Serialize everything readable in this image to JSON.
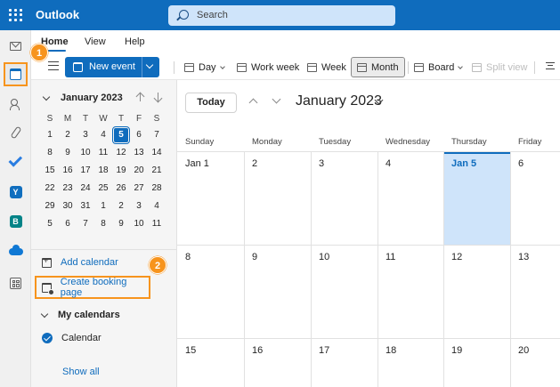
{
  "app": {
    "name": "Outlook",
    "search_placeholder": "Search"
  },
  "ribbon": {
    "tabs": [
      {
        "label": "Home"
      },
      {
        "label": "View"
      },
      {
        "label": "Help"
      }
    ],
    "new_event_label": "New event",
    "views": [
      {
        "label": "Day"
      },
      {
        "label": "Work week"
      },
      {
        "label": "Week"
      },
      {
        "label": "Month"
      },
      {
        "label": "Board"
      },
      {
        "label": "Split view"
      }
    ]
  },
  "mini_calendar": {
    "title": "January 2023",
    "day_headers": [
      "S",
      "M",
      "T",
      "W",
      "T",
      "F",
      "S"
    ],
    "weeks": [
      [
        "1",
        "2",
        "3",
        "4",
        "5",
        "6",
        "7"
      ],
      [
        "8",
        "9",
        "10",
        "11",
        "12",
        "13",
        "14"
      ],
      [
        "15",
        "16",
        "17",
        "18",
        "19",
        "20",
        "21"
      ],
      [
        "22",
        "23",
        "24",
        "25",
        "26",
        "27",
        "28"
      ],
      [
        "29",
        "30",
        "31",
        "1",
        "2",
        "3",
        "4"
      ],
      [
        "5",
        "6",
        "7",
        "8",
        "9",
        "10",
        "11"
      ]
    ]
  },
  "left_pane": {
    "add_calendar": "Add calendar",
    "create_booking_page": "Create booking page",
    "my_calendars": "My calendars",
    "calendar": "Calendar",
    "show_all": "Show all"
  },
  "badges": {
    "one": "1",
    "two": "2"
  },
  "main": {
    "today_label": "Today",
    "month_title": "January 2023",
    "weekdays": [
      "Sunday",
      "Monday",
      "Tuesday",
      "Wednesday",
      "Thursday",
      "Friday"
    ],
    "rows": [
      [
        "Jan 1",
        "2",
        "3",
        "4",
        "Jan 5",
        "6"
      ],
      [
        "8",
        "9",
        "10",
        "11",
        "12",
        "13"
      ],
      [
        "15",
        "16",
        "17",
        "18",
        "19",
        "20"
      ]
    ]
  },
  "colors": {
    "brand": "#0f6cbd",
    "highlight": "#f7941d",
    "today_bg": "#cfe4fa"
  }
}
